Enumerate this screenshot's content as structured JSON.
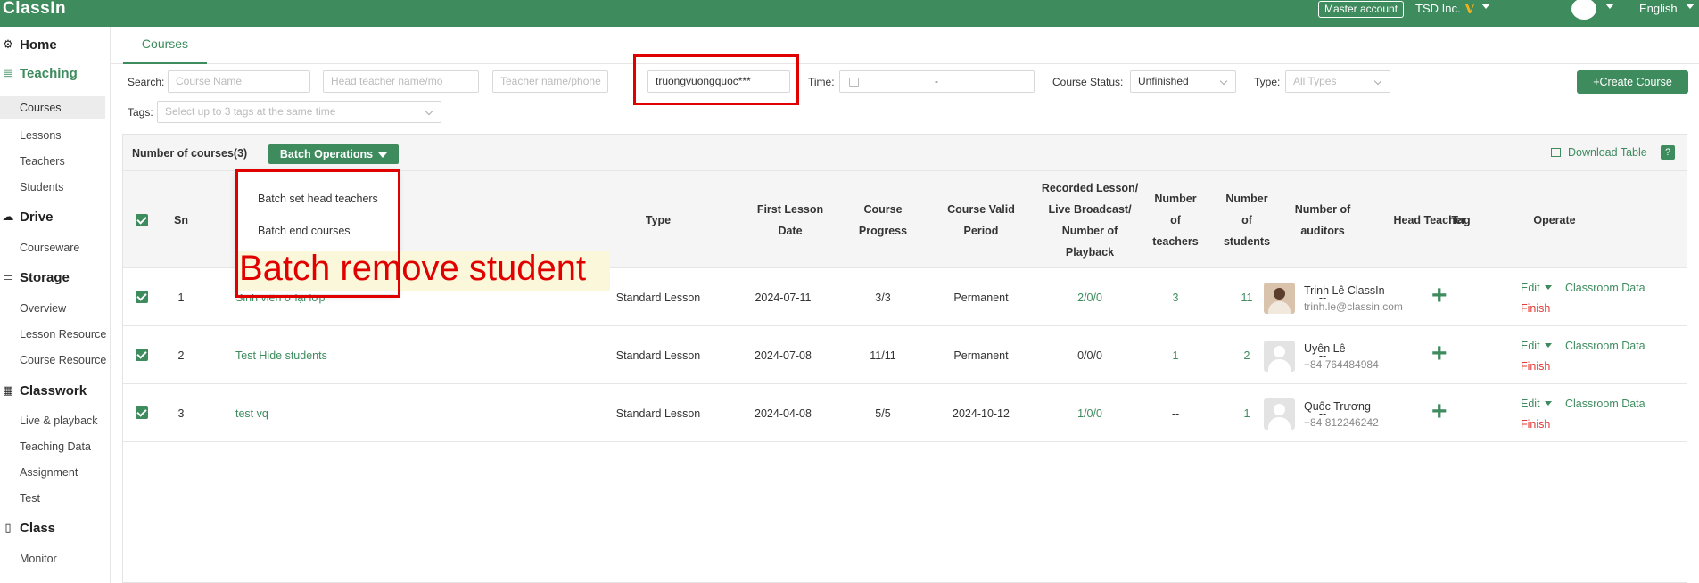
{
  "app": {
    "logo": "ClassIn"
  },
  "topbar": {
    "master_account": "Master account",
    "org": "TSD Inc.",
    "vip": "V",
    "language": "English"
  },
  "sidebar": {
    "home": "Home",
    "teaching": "Teaching",
    "teaching_items": [
      "Courses",
      "Lessons",
      "Teachers",
      "Students"
    ],
    "drive": "Drive",
    "drive_items": [
      "Courseware"
    ],
    "storage": "Storage",
    "storage_items": [
      "Overview",
      "Lesson Resource",
      "Course Resource"
    ],
    "classwork": "Classwork",
    "classwork_items": [
      "Live & playback",
      "Teaching Data",
      "Assignment",
      "Test"
    ],
    "class": "Class",
    "class_items": [
      "Monitor"
    ]
  },
  "tabs": {
    "courses": "Courses"
  },
  "filters": {
    "search_label": "Search:",
    "course_name_ph": "Course Name",
    "head_teacher_ph": "Head teacher name/mo",
    "teacher_ph": "Teacher name/phone",
    "student_value": "truongvuongquoc***",
    "time_label": "Time:",
    "time_sep": "-",
    "status_label": "Course Status:",
    "status_value": "Unfinished",
    "type_label": "Type:",
    "type_ph": "All Types",
    "tags_label": "Tags:",
    "tags_ph": "Select up to 3 tags at the same time",
    "create_btn": "+Create Course"
  },
  "table": {
    "count": "Number of courses(3)",
    "batch_btn": "Batch Operations",
    "download": "Download Table",
    "help": "?",
    "headers": {
      "sn": "Sn",
      "type": "Type",
      "first_lesson": "First Lesson Date",
      "progress": "Course Progress",
      "valid": "Course Valid Period",
      "recorded": "Recorded Lesson/ Live Broadcast/ Number of Playback",
      "teachers": "Number of teachers",
      "students": "Number of students",
      "auditors": "Number of auditors",
      "head_teacher": "Head Teacher",
      "tag": "Tag",
      "operate": "Operate"
    },
    "rows": [
      {
        "sn": "1",
        "name": "Sinh viên ở lại lớp",
        "type": "Standard Lesson",
        "date": "2024-07-11",
        "progress": "3/3",
        "valid": "Permanent",
        "recorded": "2/0/0",
        "teachers": "3",
        "students": "11",
        "auditors": "--",
        "ht_name": "Trinh Lê ClassIn",
        "ht_sub": "trinh.le@classin.com",
        "edit": "Edit",
        "cdata": "Classroom Data",
        "finish": "Finish"
      },
      {
        "sn": "2",
        "name": "Test Hide students",
        "type": "Standard Lesson",
        "date": "2024-07-08",
        "progress": "11/11",
        "valid": "Permanent",
        "recorded": "0/0/0",
        "teachers": "1",
        "students": "2",
        "auditors": "--",
        "ht_name": "Uyên Lê",
        "ht_sub": "+84 764484984",
        "edit": "Edit",
        "cdata": "Classroom Data",
        "finish": "Finish"
      },
      {
        "sn": "3",
        "name": "test vq",
        "type": "Standard Lesson",
        "date": "2024-04-08",
        "progress": "5/5",
        "valid": "2024-10-12",
        "recorded": "1/0/0",
        "teachers": "--",
        "students": "1",
        "auditors": "--",
        "ht_name": "Quốc Trương",
        "ht_sub": "+84 812246242",
        "edit": "Edit",
        "cdata": "Classroom Data",
        "finish": "Finish"
      }
    ]
  },
  "dropdown": {
    "items": [
      "Batch set head teachers",
      "Batch end courses"
    ]
  },
  "annotation": "Batch remove student",
  "colors": {
    "brand": "#3e8b5e",
    "danger": "#e53935",
    "highlight": "#e10000"
  }
}
